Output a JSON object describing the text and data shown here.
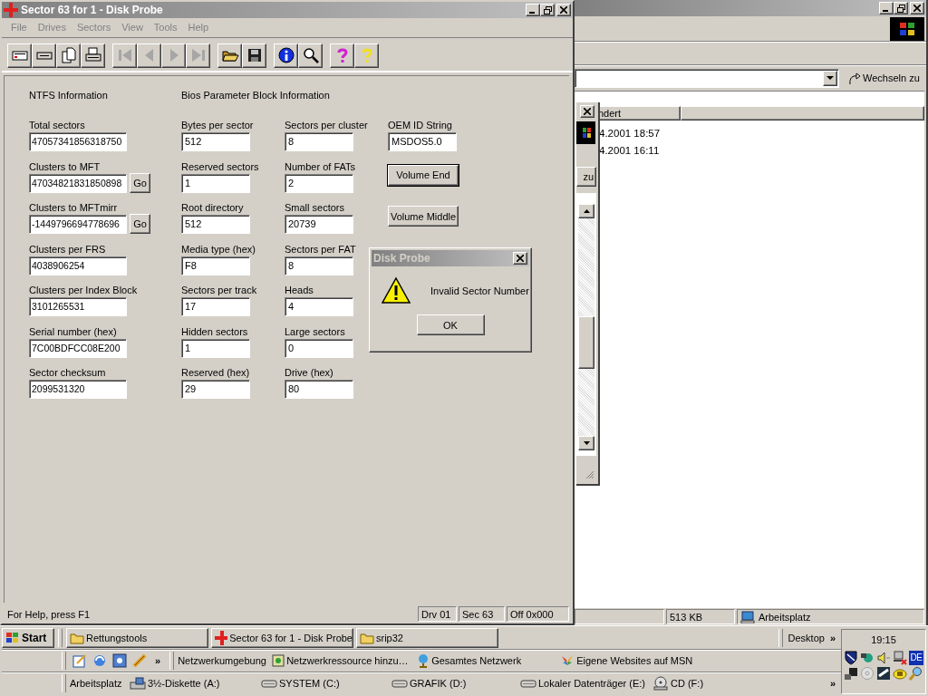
{
  "main_window": {
    "title": "Sector 63 for 1 - Disk Probe",
    "menu": [
      {
        "label": "File",
        "disabled": true
      },
      {
        "label": "Drives",
        "disabled": true
      },
      {
        "label": "Sectors",
        "disabled": true
      },
      {
        "label": "View",
        "disabled": true
      },
      {
        "label": "Tools",
        "disabled": true
      },
      {
        "label": "Help",
        "disabled": true
      }
    ],
    "toolbar_groups": [
      {
        "buttons": [
          {
            "kind": "sector",
            "disabled": false
          },
          {
            "kind": "partition",
            "disabled": false
          },
          {
            "kind": "pages",
            "disabled": false
          },
          {
            "kind": "print",
            "disabled": false
          }
        ]
      },
      {
        "buttons": [
          {
            "kind": "first",
            "disabled": true
          },
          {
            "kind": "previous",
            "disabled": true
          },
          {
            "kind": "next",
            "disabled": true
          },
          {
            "kind": "last",
            "disabled": true
          }
        ]
      },
      {
        "buttons": [
          {
            "kind": "open",
            "disabled": false
          },
          {
            "kind": "save",
            "disabled": false
          }
        ]
      },
      {
        "buttons": [
          {
            "kind": "info",
            "disabled": false
          },
          {
            "kind": "search",
            "disabled": false
          }
        ]
      },
      {
        "buttons": [
          {
            "kind": "help",
            "disabled": false
          },
          {
            "kind": "context_help",
            "disabled": false
          }
        ]
      }
    ],
    "ntfs": {
      "heading": "NTFS Information",
      "fields": [
        {
          "label": "Total sectors",
          "value": "47057341856318750"
        },
        {
          "label": "Clusters to MFT",
          "value": "47034821831850898",
          "button": "Go"
        },
        {
          "label": "Clusters to MFTmirr",
          "value": "-1449796694778696",
          "button": "Go"
        },
        {
          "label": "Clusters per FRS",
          "value": "4038906254"
        },
        {
          "label": "Clusters per Index Block",
          "value": "3101265531"
        },
        {
          "label": "Serial number (hex)",
          "value": "7C00BDFCC08E200"
        },
        {
          "label": "Sector checksum",
          "value": "2099531320"
        }
      ]
    },
    "bpb": {
      "heading": "Bios Parameter Block Information",
      "fields": [
        {
          "label": "Bytes per sector",
          "value": "512"
        },
        {
          "label": "Sectors per cluster",
          "value": "8"
        },
        {
          "label": "Reserved sectors",
          "value": "1"
        },
        {
          "label": "Number of FATs",
          "value": "2"
        },
        {
          "label": "Root directory",
          "value": "512"
        },
        {
          "label": "Small sectors",
          "value": "20739"
        },
        {
          "label": "Media type (hex)",
          "value": "F8"
        },
        {
          "label": "Sectors per FAT",
          "value": "8"
        },
        {
          "label": "Sectors per track",
          "value": "17"
        },
        {
          "label": "Heads",
          "value": "4"
        },
        {
          "label": "Hidden sectors",
          "value": "1"
        },
        {
          "label": "Large sectors",
          "value": "0"
        },
        {
          "label": "Reserved (hex)",
          "value": "29"
        },
        {
          "label": "Drive (hex)",
          "value": "80"
        }
      ]
    },
    "oem": {
      "label": "OEM ID String",
      "value": "MSDOS5.0"
    },
    "buttons": [
      {
        "label": "Volume End",
        "default": true
      },
      {
        "label": "Volume Middle",
        "default": false
      }
    ],
    "status_bar": [
      "For Help, press F1",
      "Drv  01",
      "Sec 63",
      "Off 0x000"
    ]
  },
  "dialog": {
    "title": "Disk Probe",
    "message": "Invalid Sector Number",
    "button": "OK"
  },
  "explorer_window": {
    "address_button": "Wechseln zu",
    "columns": [
      "ndert"
    ],
    "rows": [
      "4.2001 18:57",
      "4.2001 16:11"
    ],
    "side_button": "zu",
    "status_bar": [
      "513 KB",
      "Arbeitsplatz"
    ]
  },
  "taskbar": {
    "start": "Start",
    "tasks": [
      {
        "label": "Rettungstools",
        "kind": "folder",
        "selected": false
      },
      {
        "label": "Sector 63 for 1 - Disk Probe",
        "kind": "cross",
        "selected": false
      },
      {
        "label": "srip32",
        "kind": "folder",
        "selected": false
      }
    ],
    "desktop_toolbar": {
      "label": "Desktop",
      "more": "»"
    },
    "quick_launch": [
      {
        "kind": "edit"
      },
      {
        "kind": "refresh"
      },
      {
        "kind": "viewer"
      },
      {
        "kind": "tool"
      }
    ],
    "quick_launch_more": "»",
    "links": [
      {
        "label": "Netzwerkumgebung",
        "kind": "none"
      },
      {
        "label": "Netzwerkressource hinzu…",
        "kind": "network_add"
      },
      {
        "label": "Gesamtes Netzwerk",
        "kind": "globe"
      },
      {
        "label": "Eigene Websites auf MSN",
        "kind": "butterfly"
      }
    ],
    "drives": [
      {
        "label": "Arbeitsplatz",
        "kind": "none"
      },
      {
        "label": "3½-Diskette (A:)",
        "kind": "floppy"
      },
      {
        "label": "SYSTEM (C:)",
        "kind": "disk"
      },
      {
        "label": "GRAFIK (D:)",
        "kind": "disk"
      },
      {
        "label": "Lokaler Datenträger (E:)",
        "kind": "disk"
      },
      {
        "label": "CD (F:)",
        "kind": "cd"
      }
    ],
    "drives_more": "»",
    "tray": {
      "clock": "19:15",
      "language": "DE",
      "icons": [
        {
          "kind": "shield"
        },
        {
          "kind": "network"
        },
        {
          "kind": "speaker"
        },
        {
          "kind": "disconnected"
        },
        {
          "kind": "terminal"
        },
        {
          "kind": "disc"
        },
        {
          "kind": "scanner"
        },
        {
          "kind": "coin"
        },
        {
          "kind": "magnifier"
        }
      ]
    }
  }
}
